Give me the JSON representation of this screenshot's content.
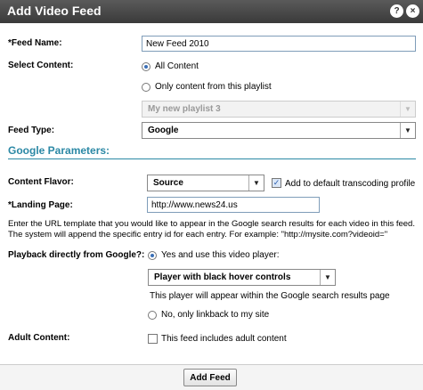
{
  "dialog": {
    "title": "Add Video Feed",
    "help_icon": "?",
    "close_icon": "×"
  },
  "feed_name": {
    "label": "*Feed Name:",
    "value": "New Feed 2010"
  },
  "select_content": {
    "label": "Select Content:",
    "options": [
      {
        "label": "All Content",
        "selected": true
      },
      {
        "label": "Only content from this playlist",
        "selected": false
      }
    ],
    "playlist_select": {
      "value": "My new playlist 3",
      "disabled": true
    }
  },
  "feed_type": {
    "label": "Feed Type:",
    "value": "Google"
  },
  "google_section": {
    "title": "Google Parameters:"
  },
  "content_flavor": {
    "label": "Content Flavor:",
    "value": "Source",
    "checkbox_label": "Add to default transcoding profile",
    "checkbox_checked": true
  },
  "landing_page": {
    "label": "*Landing Page:",
    "value": "http://www.news24.us",
    "description": "Enter the URL template that you would like to appear in the Google search results for each video in this feed.  The system will append the specific entry id for each entry. For example: \"http://mysite.com?videoid=\""
  },
  "playback": {
    "label": "Playback directly from Google?:",
    "options": [
      {
        "label": "Yes and use this video player:",
        "selected": true
      },
      {
        "label": "No, only linkback to my site",
        "selected": false
      }
    ],
    "player_select": "Player with black hover controls",
    "player_note": "This player will appear within the Google search results page"
  },
  "adult_content": {
    "label": "Adult Content:",
    "checkbox_label": "This feed includes adult content",
    "checked": false
  },
  "footer": {
    "add_button": "Add Feed"
  },
  "colors": {
    "section_title": "#2b88a5",
    "titlebar": "#4a4a4a",
    "radio_selected": "#3b6fb6"
  }
}
